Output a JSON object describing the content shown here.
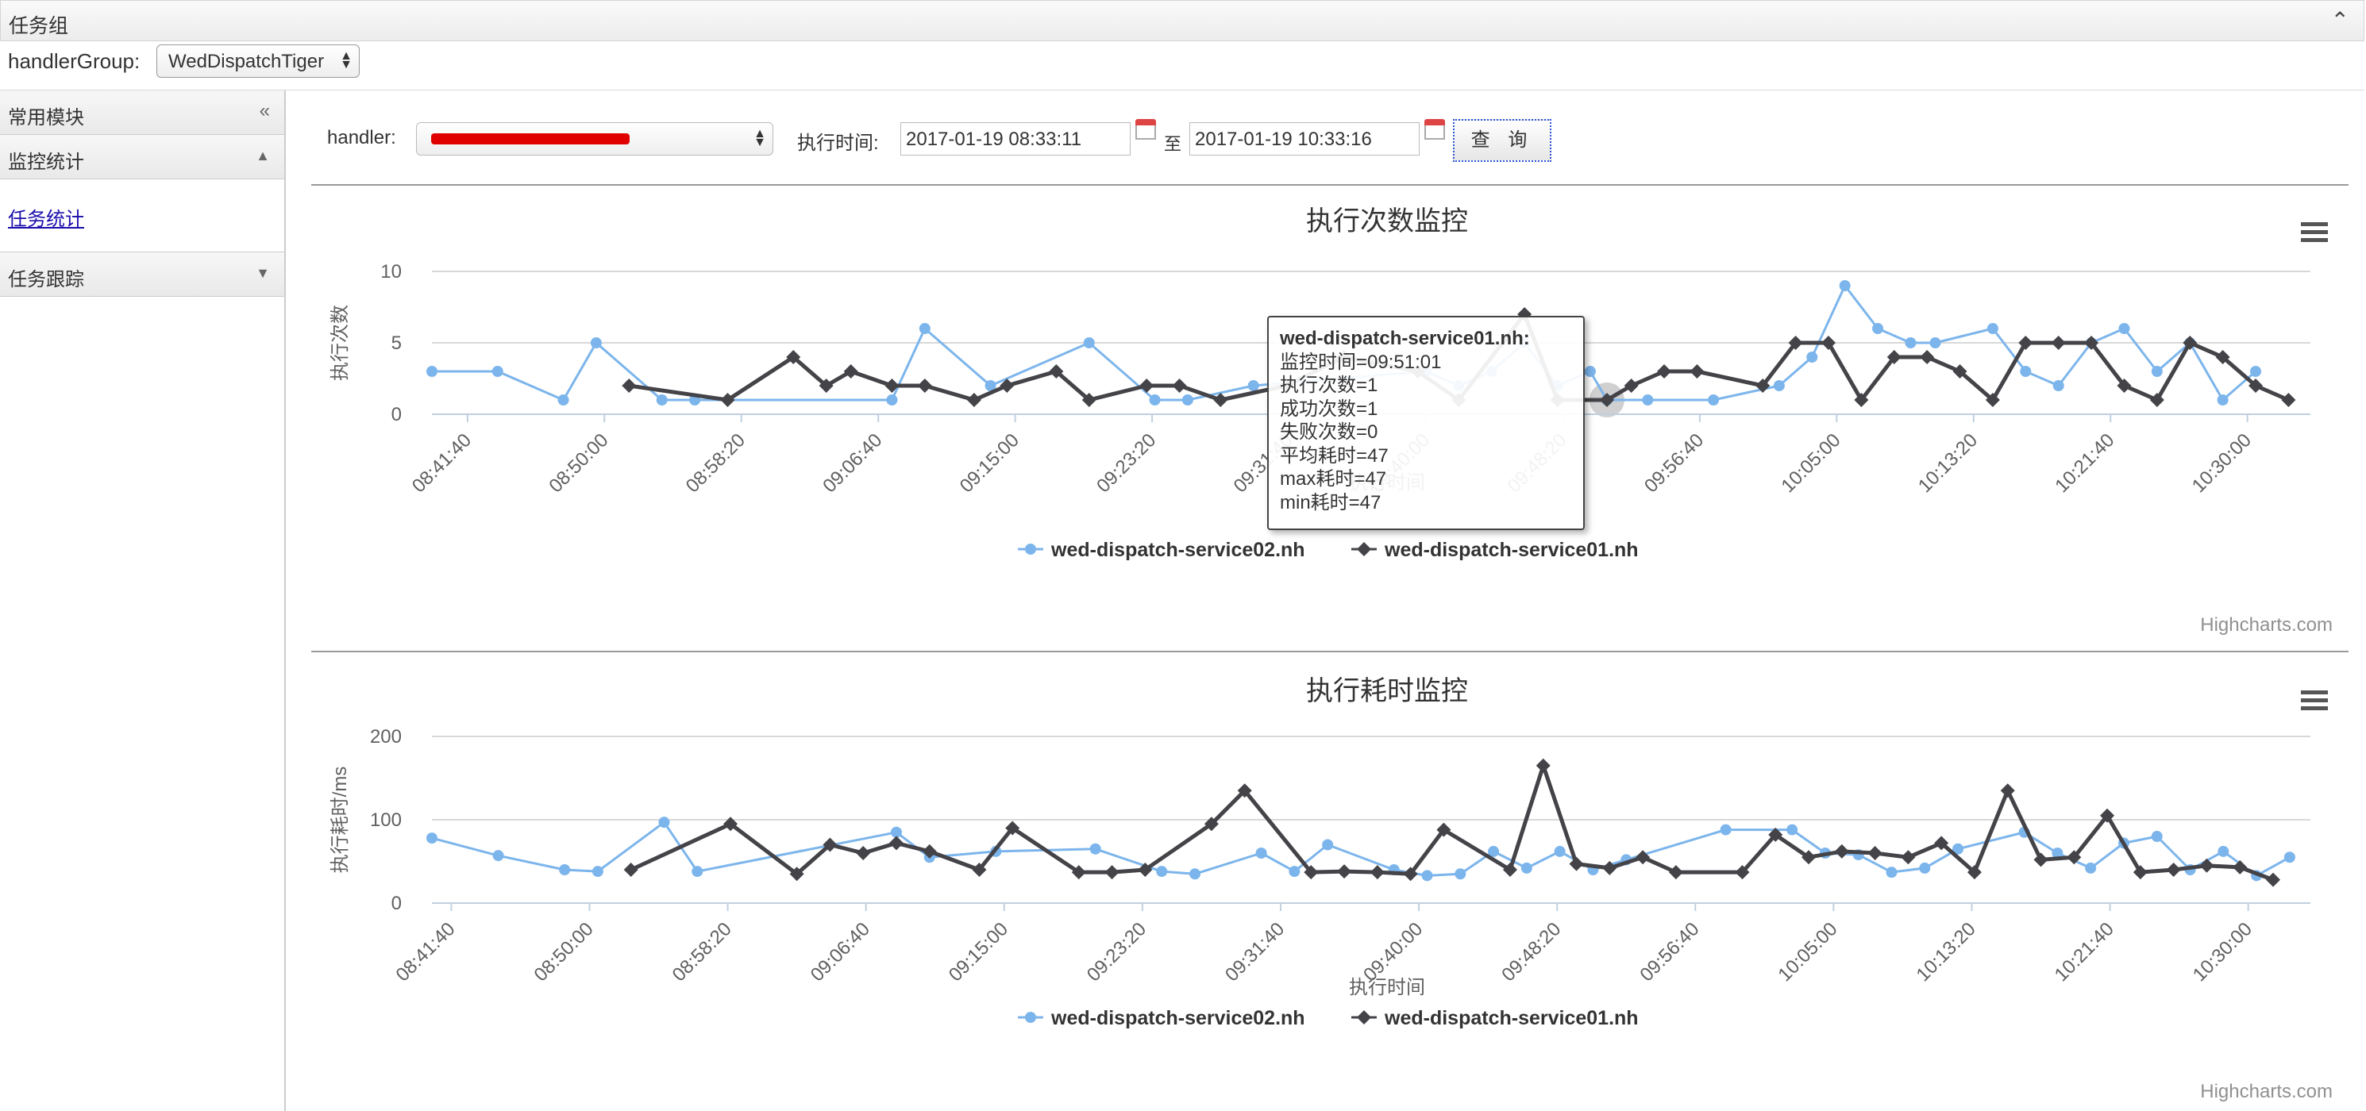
{
  "topbar": {
    "title": "任务组",
    "collapse_icon": "double-chevron-up-icon"
  },
  "handler_group": {
    "label": "handlerGroup:",
    "value": "WedDispatchTiger"
  },
  "sidebar": {
    "section_title": "常用模块",
    "sections": [
      {
        "title": "监控统计",
        "expanded": true,
        "items": [
          "任务统计"
        ]
      },
      {
        "title": "任务跟踪",
        "expanded": false,
        "items": []
      }
    ]
  },
  "toolbar": {
    "handler_label": "handler:",
    "handler_value": "",
    "time_label": "执行时间:",
    "start_time": "2017-01-19 08:33:11",
    "to_label": "至",
    "end_time": "2017-01-19 10:33:16",
    "query_button": "查 询"
  },
  "colors": {
    "service02": "#7cb5ec",
    "service01": "#434348",
    "redaction": "#e00000"
  },
  "chart_data": [
    {
      "type": "line",
      "title": "执行次数监控",
      "xlabel": "执行时间",
      "ylabel": "执行次数",
      "ylim": [
        0,
        10
      ],
      "yticks": [
        0,
        5,
        10
      ],
      "xlim": [
        "08:39:30",
        "10:33:50"
      ],
      "xticks": [
        "08:41:40",
        "08:50:00",
        "08:58:20",
        "09:06:40",
        "09:15:00",
        "09:23:20",
        "09:31:40",
        "09:40:00",
        "09:48:20",
        "09:56:40",
        "10:05:00",
        "10:13:20",
        "10:21:40",
        "10:30:00"
      ],
      "legend": "bottom-center",
      "credits": "Highcharts.com",
      "series": [
        {
          "name": "wed-dispatch-service02.nh",
          "marker": "circle",
          "points": [
            [
              "08:39:30",
              3
            ],
            [
              "08:43:30",
              3
            ],
            [
              "08:47:30",
              1
            ],
            [
              "08:49:30",
              5
            ],
            [
              "08:53:30",
              1
            ],
            [
              "08:55:30",
              1
            ],
            [
              "09:07:30",
              1
            ],
            [
              "09:09:30",
              6
            ],
            [
              "09:13:30",
              2
            ],
            [
              "09:19:30",
              5
            ],
            [
              "09:23:30",
              1
            ],
            [
              "09:25:30",
              1
            ],
            [
              "09:29:30",
              2
            ],
            [
              "09:40:00",
              3
            ],
            [
              "09:42:00",
              2
            ],
            [
              "09:44:00",
              3
            ],
            [
              "09:46:00",
              5
            ],
            [
              "09:48:00",
              2
            ],
            [
              "09:50:00",
              3
            ],
            [
              "09:51:01",
              1
            ],
            [
              "09:53:30",
              1
            ],
            [
              "09:57:30",
              1
            ],
            [
              "10:01:30",
              2
            ],
            [
              "10:03:30",
              4
            ],
            [
              "10:05:30",
              9
            ],
            [
              "10:07:30",
              6
            ],
            [
              "10:09:30",
              5
            ],
            [
              "10:11:00",
              5
            ],
            [
              "10:14:30",
              6
            ],
            [
              "10:16:30",
              3
            ],
            [
              "10:18:30",
              2
            ],
            [
              "10:20:30",
              5
            ],
            [
              "10:22:30",
              6
            ],
            [
              "10:24:30",
              3
            ],
            [
              "10:26:30",
              5
            ],
            [
              "10:28:30",
              1
            ],
            [
              "10:30:30",
              3
            ]
          ]
        },
        {
          "name": "wed-dispatch-service01.nh",
          "marker": "diamond",
          "points": [
            [
              "08:51:30",
              2
            ],
            [
              "08:57:30",
              1
            ],
            [
              "09:01:30",
              4
            ],
            [
              "09:03:30",
              2
            ],
            [
              "09:05:00",
              3
            ],
            [
              "09:07:30",
              2
            ],
            [
              "09:09:30",
              2
            ],
            [
              "09:12:30",
              1
            ],
            [
              "09:14:30",
              2
            ],
            [
              "09:17:30",
              3
            ],
            [
              "09:19:30",
              1
            ],
            [
              "09:23:00",
              2
            ],
            [
              "09:25:00",
              2
            ],
            [
              "09:27:30",
              1
            ],
            [
              "09:31:30",
              2
            ],
            [
              "09:35:00",
              4
            ],
            [
              "09:39:30",
              3
            ],
            [
              "09:42:00",
              1
            ],
            [
              "09:46:00",
              7
            ],
            [
              "09:48:00",
              1
            ],
            [
              "09:51:01",
              1
            ],
            [
              "09:52:30",
              2
            ],
            [
              "09:54:30",
              3
            ],
            [
              "09:56:30",
              3
            ],
            [
              "10:00:30",
              2
            ],
            [
              "10:02:30",
              5
            ],
            [
              "10:04:30",
              5
            ],
            [
              "10:06:30",
              1
            ],
            [
              "10:08:30",
              4
            ],
            [
              "10:10:30",
              4
            ],
            [
              "10:12:30",
              3
            ],
            [
              "10:14:30",
              1
            ],
            [
              "10:16:30",
              5
            ],
            [
              "10:18:30",
              5
            ],
            [
              "10:20:30",
              5
            ],
            [
              "10:22:30",
              2
            ],
            [
              "10:24:30",
              1
            ],
            [
              "10:26:30",
              5
            ],
            [
              "10:28:30",
              4
            ],
            [
              "10:30:30",
              2
            ],
            [
              "10:32:30",
              1
            ]
          ]
        }
      ],
      "tooltip": {
        "title": "wed-dispatch-service01.nh",
        "lines": [
          "监控时间=09:51:01",
          "执行次数=1",
          "成功次数=1",
          "失败次数=0",
          "平均耗时=47",
          "max耗时=47",
          "min耗时=47"
        ]
      }
    },
    {
      "type": "line",
      "title": "执行耗时监控",
      "xlabel": "执行时间",
      "ylabel": "执行耗时/ms",
      "ylim": [
        0,
        200
      ],
      "yticks": [
        0,
        100,
        200
      ],
      "xlim": [
        "08:40:30",
        "10:33:45"
      ],
      "xticks": [
        "08:41:40",
        "08:50:00",
        "08:58:20",
        "09:06:40",
        "09:15:00",
        "09:23:20",
        "09:31:40",
        "09:40:00",
        "09:48:20",
        "09:56:40",
        "10:05:00",
        "10:13:20",
        "10:21:40",
        "10:30:00"
      ],
      "legend": "bottom-center",
      "credits": "Highcharts.com",
      "series": [
        {
          "name": "wed-dispatch-service02.nh",
          "marker": "circle",
          "points": [
            [
              "08:40:30",
              78
            ],
            [
              "08:44:30",
              57
            ],
            [
              "08:48:30",
              40
            ],
            [
              "08:50:30",
              38
            ],
            [
              "08:54:30",
              97
            ],
            [
              "08:56:30",
              38
            ],
            [
              "09:08:30",
              85
            ],
            [
              "09:10:30",
              55
            ],
            [
              "09:14:30",
              62
            ],
            [
              "09:20:30",
              65
            ],
            [
              "09:24:30",
              38
            ],
            [
              "09:26:30",
              35
            ],
            [
              "09:30:30",
              60
            ],
            [
              "09:32:30",
              38
            ],
            [
              "09:34:30",
              70
            ],
            [
              "09:38:30",
              40
            ],
            [
              "09:40:30",
              33
            ],
            [
              "09:42:30",
              35
            ],
            [
              "09:44:30",
              62
            ],
            [
              "09:46:30",
              42
            ],
            [
              "09:48:30",
              62
            ],
            [
              "09:50:30",
              40
            ],
            [
              "09:52:30",
              52
            ],
            [
              "09:58:30",
              88
            ],
            [
              "10:02:30",
              88
            ],
            [
              "10:04:30",
              60
            ],
            [
              "10:06:30",
              58
            ],
            [
              "10:08:30",
              37
            ],
            [
              "10:10:30",
              42
            ],
            [
              "10:12:30",
              65
            ],
            [
              "10:16:30",
              85
            ],
            [
              "10:18:30",
              60
            ],
            [
              "10:20:30",
              42
            ],
            [
              "10:22:30",
              72
            ],
            [
              "10:24:30",
              80
            ],
            [
              "10:26:30",
              40
            ],
            [
              "10:28:30",
              62
            ],
            [
              "10:30:30",
              33
            ],
            [
              "10:32:30",
              55
            ]
          ]
        },
        {
          "name": "wed-dispatch-service01.nh",
          "marker": "diamond",
          "points": [
            [
              "08:52:30",
              40
            ],
            [
              "08:58:30",
              95
            ],
            [
              "09:02:30",
              35
            ],
            [
              "09:04:30",
              70
            ],
            [
              "09:06:30",
              60
            ],
            [
              "09:08:30",
              72
            ],
            [
              "09:10:30",
              62
            ],
            [
              "09:13:30",
              40
            ],
            [
              "09:15:30",
              90
            ],
            [
              "09:19:30",
              37
            ],
            [
              "09:21:30",
              37
            ],
            [
              "09:23:30",
              40
            ],
            [
              "09:27:30",
              95
            ],
            [
              "09:29:30",
              135
            ],
            [
              "09:33:30",
              37
            ],
            [
              "09:35:30",
              38
            ],
            [
              "09:37:30",
              37
            ],
            [
              "09:39:30",
              35
            ],
            [
              "09:41:30",
              88
            ],
            [
              "09:45:30",
              40
            ],
            [
              "09:47:30",
              165
            ],
            [
              "09:49:30",
              47
            ],
            [
              "09:51:30",
              42
            ],
            [
              "09:53:30",
              55
            ],
            [
              "09:55:30",
              37
            ],
            [
              "09:59:30",
              37
            ],
            [
              "10:01:30",
              82
            ],
            [
              "10:03:30",
              55
            ],
            [
              "10:05:30",
              62
            ],
            [
              "10:07:30",
              60
            ],
            [
              "10:09:30",
              55
            ],
            [
              "10:11:30",
              72
            ],
            [
              "10:13:30",
              37
            ],
            [
              "10:15:30",
              135
            ],
            [
              "10:17:30",
              52
            ],
            [
              "10:19:30",
              55
            ],
            [
              "10:21:30",
              105
            ],
            [
              "10:23:30",
              37
            ],
            [
              "10:25:30",
              40
            ],
            [
              "10:27:30",
              45
            ],
            [
              "10:29:30",
              43
            ],
            [
              "10:31:30",
              28
            ]
          ]
        }
      ]
    }
  ]
}
